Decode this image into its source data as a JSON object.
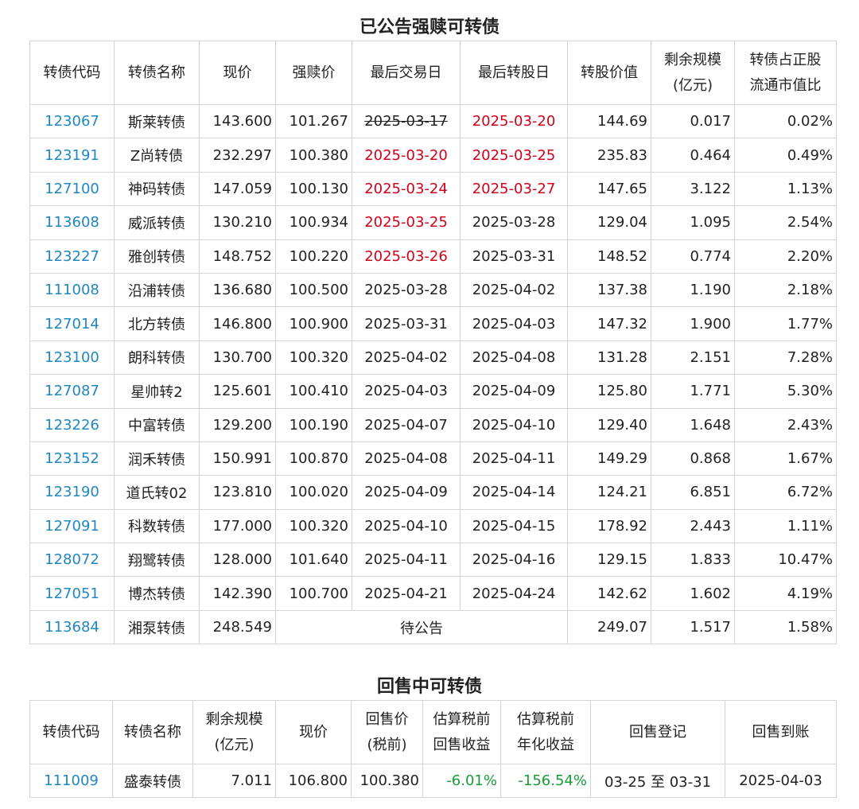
{
  "table1": {
    "title": "已公告强赎可转债",
    "headers": [
      "转债代码",
      "转债名称",
      "现价",
      "强赎价",
      "最后交易日",
      "最后转股日",
      "转股价值",
      "剩余规模\n(亿元)",
      "转债占正股\n流通市值比"
    ],
    "rows": [
      {
        "code": "123067",
        "name": "斯莱转债",
        "price": "143.600",
        "redeem": "101.267",
        "last_trade": "2025-03-17",
        "last_trade_style": "strike",
        "last_conv": "2025-03-20",
        "last_conv_style": "red",
        "conv_value": "144.69",
        "remain": "0.017",
        "ratio": "0.02%"
      },
      {
        "code": "123191",
        "name": "Z尚转债",
        "price": "232.297",
        "redeem": "100.380",
        "last_trade": "2025-03-20",
        "last_trade_style": "red",
        "last_conv": "2025-03-25",
        "last_conv_style": "red",
        "conv_value": "235.83",
        "remain": "0.464",
        "ratio": "0.49%"
      },
      {
        "code": "127100",
        "name": "神码转债",
        "price": "147.059",
        "redeem": "100.130",
        "last_trade": "2025-03-24",
        "last_trade_style": "red",
        "last_conv": "2025-03-27",
        "last_conv_style": "red",
        "conv_value": "147.65",
        "remain": "3.122",
        "ratio": "1.13%"
      },
      {
        "code": "113608",
        "name": "威派转债",
        "price": "130.210",
        "redeem": "100.934",
        "last_trade": "2025-03-25",
        "last_trade_style": "red",
        "last_conv": "2025-03-28",
        "last_conv_style": "",
        "conv_value": "129.04",
        "remain": "1.095",
        "ratio": "2.54%"
      },
      {
        "code": "123227",
        "name": "雅创转债",
        "price": "148.752",
        "redeem": "100.220",
        "last_trade": "2025-03-26",
        "last_trade_style": "red",
        "last_conv": "2025-03-31",
        "last_conv_style": "",
        "conv_value": "148.52",
        "remain": "0.774",
        "ratio": "2.20%"
      },
      {
        "code": "111008",
        "name": "沿浦转债",
        "price": "136.680",
        "redeem": "100.500",
        "last_trade": "2025-03-28",
        "last_trade_style": "",
        "last_conv": "2025-04-02",
        "last_conv_style": "",
        "conv_value": "137.38",
        "remain": "1.190",
        "ratio": "2.18%"
      },
      {
        "code": "127014",
        "name": "北方转债",
        "price": "146.800",
        "redeem": "100.900",
        "last_trade": "2025-03-31",
        "last_trade_style": "",
        "last_conv": "2025-04-03",
        "last_conv_style": "",
        "conv_value": "147.32",
        "remain": "1.900",
        "ratio": "1.77%"
      },
      {
        "code": "123100",
        "name": "朗科转债",
        "price": "130.700",
        "redeem": "100.320",
        "last_trade": "2025-04-02",
        "last_trade_style": "",
        "last_conv": "2025-04-08",
        "last_conv_style": "",
        "conv_value": "131.28",
        "remain": "2.151",
        "ratio": "7.28%"
      },
      {
        "code": "127087",
        "name": "星帅转2",
        "price": "125.601",
        "redeem": "100.410",
        "last_trade": "2025-04-03",
        "last_trade_style": "",
        "last_conv": "2025-04-09",
        "last_conv_style": "",
        "conv_value": "125.80",
        "remain": "1.771",
        "ratio": "5.30%"
      },
      {
        "code": "123226",
        "name": "中富转债",
        "price": "129.200",
        "redeem": "100.190",
        "last_trade": "2025-04-07",
        "last_trade_style": "",
        "last_conv": "2025-04-10",
        "last_conv_style": "",
        "conv_value": "129.40",
        "remain": "1.648",
        "ratio": "2.43%"
      },
      {
        "code": "123152",
        "name": "润禾转债",
        "price": "150.991",
        "redeem": "100.870",
        "last_trade": "2025-04-08",
        "last_trade_style": "",
        "last_conv": "2025-04-11",
        "last_conv_style": "",
        "conv_value": "149.29",
        "remain": "0.868",
        "ratio": "1.67%"
      },
      {
        "code": "123190",
        "name": "道氏转02",
        "price": "123.810",
        "redeem": "100.020",
        "last_trade": "2025-04-09",
        "last_trade_style": "",
        "last_conv": "2025-04-14",
        "last_conv_style": "",
        "conv_value": "124.21",
        "remain": "6.851",
        "ratio": "6.72%"
      },
      {
        "code": "127091",
        "name": "科数转债",
        "price": "177.000",
        "redeem": "100.320",
        "last_trade": "2025-04-10",
        "last_trade_style": "",
        "last_conv": "2025-04-15",
        "last_conv_style": "",
        "conv_value": "178.92",
        "remain": "2.443",
        "ratio": "1.11%"
      },
      {
        "code": "128072",
        "name": "翔鹭转债",
        "price": "128.000",
        "redeem": "101.640",
        "last_trade": "2025-04-11",
        "last_trade_style": "",
        "last_conv": "2025-04-16",
        "last_conv_style": "",
        "conv_value": "129.15",
        "remain": "1.833",
        "ratio": "10.47%"
      },
      {
        "code": "127051",
        "name": "博杰转债",
        "price": "142.390",
        "redeem": "100.700",
        "last_trade": "2025-04-21",
        "last_trade_style": "",
        "last_conv": "2025-04-24",
        "last_conv_style": "",
        "conv_value": "142.62",
        "remain": "1.602",
        "ratio": "4.19%"
      }
    ],
    "pending_row": {
      "code": "113684",
      "name": "湘泵转债",
      "price": "248.549",
      "pending_label": "待公告",
      "conv_value": "249.07",
      "remain": "1.517",
      "ratio": "1.58%"
    }
  },
  "table2": {
    "title": "回售中可转债",
    "headers": [
      "转债代码",
      "转债名称",
      "剩余规模\n(亿元)",
      "现价",
      "回售价\n(税前)",
      "估算税前\n回售收益",
      "估算税前\n年化收益",
      "回售登记",
      "回售到账"
    ],
    "rows": [
      {
        "code": "111009",
        "name": "盛泰转债",
        "remain": "7.011",
        "price": "106.800",
        "putback_price": "100.380",
        "yield": "-6.01%",
        "annual_yield": "-156.54%",
        "register": "03-25 至 03-31",
        "arrival": "2025-04-03"
      }
    ]
  },
  "colors": {
    "code_link": "#1f87c1",
    "red": "#d0021b",
    "green": "#1a9b3a",
    "border": "#d4d4d4"
  }
}
